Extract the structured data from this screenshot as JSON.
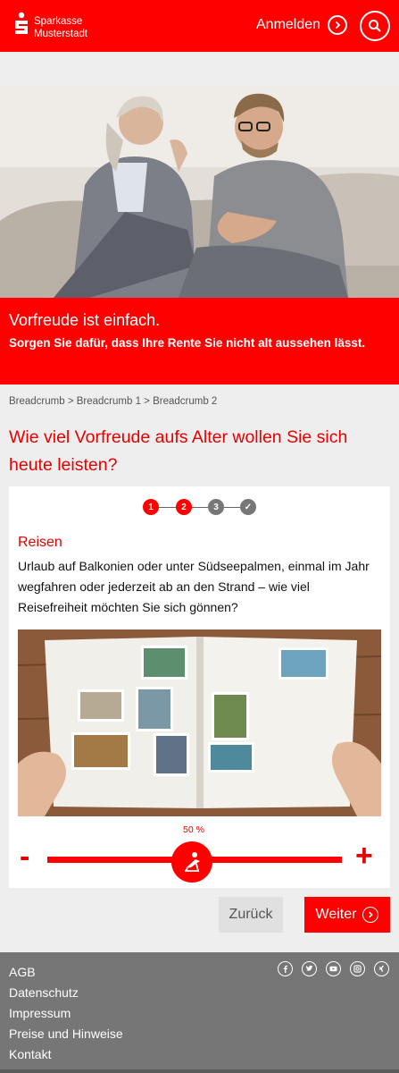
{
  "header": {
    "brand_line1": "Sparkasse",
    "brand_line2": "Musterstadt",
    "login_label": "Anmelden",
    "login_icon": "chevron-right-circle-icon",
    "search_icon": "search-icon"
  },
  "hero": {
    "image": "two-men-laughing-on-sofa",
    "title": "Vorfreude ist einfach.",
    "subtitle": "Sorgen Sie dafür, dass Ihre Rente Sie nicht alt aussehen lässt."
  },
  "breadcrumb": "Breadcrumb > Breadcrumb 1 > Breadcrumb 2",
  "page_title": "Wie viel Vorfreude aufs Alter wollen Sie sich heute leisten?",
  "stepper": {
    "steps": [
      "1",
      "2",
      "3",
      "✓"
    ],
    "current_step": 2
  },
  "section": {
    "title": "Reisen",
    "text": "Urlaub auf Balkonien oder unter Südseepalmen, einmal im Jahr wegfahren oder jederzeit ab an den Strand – wie viel Reisefreiheit möchten Sie sich gönnen?",
    "image": "photo-album-travel"
  },
  "slider": {
    "value_label": "50 %",
    "value": 0.5,
    "minus_label": "-",
    "plus_label": "+",
    "thumb_icon": "beach-chair-icon"
  },
  "buttons": {
    "back_label": "Zurück",
    "next_label": "Weiter"
  },
  "footer": {
    "links": [
      "AGB",
      "Datenschutz",
      "Impressum",
      "Preise und Hinweise",
      "Kontakt"
    ],
    "social_icons": [
      "facebook-icon",
      "twitter-icon",
      "youtube-icon",
      "instagram-icon",
      "xing-icon"
    ]
  },
  "colors": {
    "brand_red": "#ff0000",
    "text_red": "#e60000",
    "footer_gray": "#767676",
    "page_bg": "#eeeeee"
  }
}
